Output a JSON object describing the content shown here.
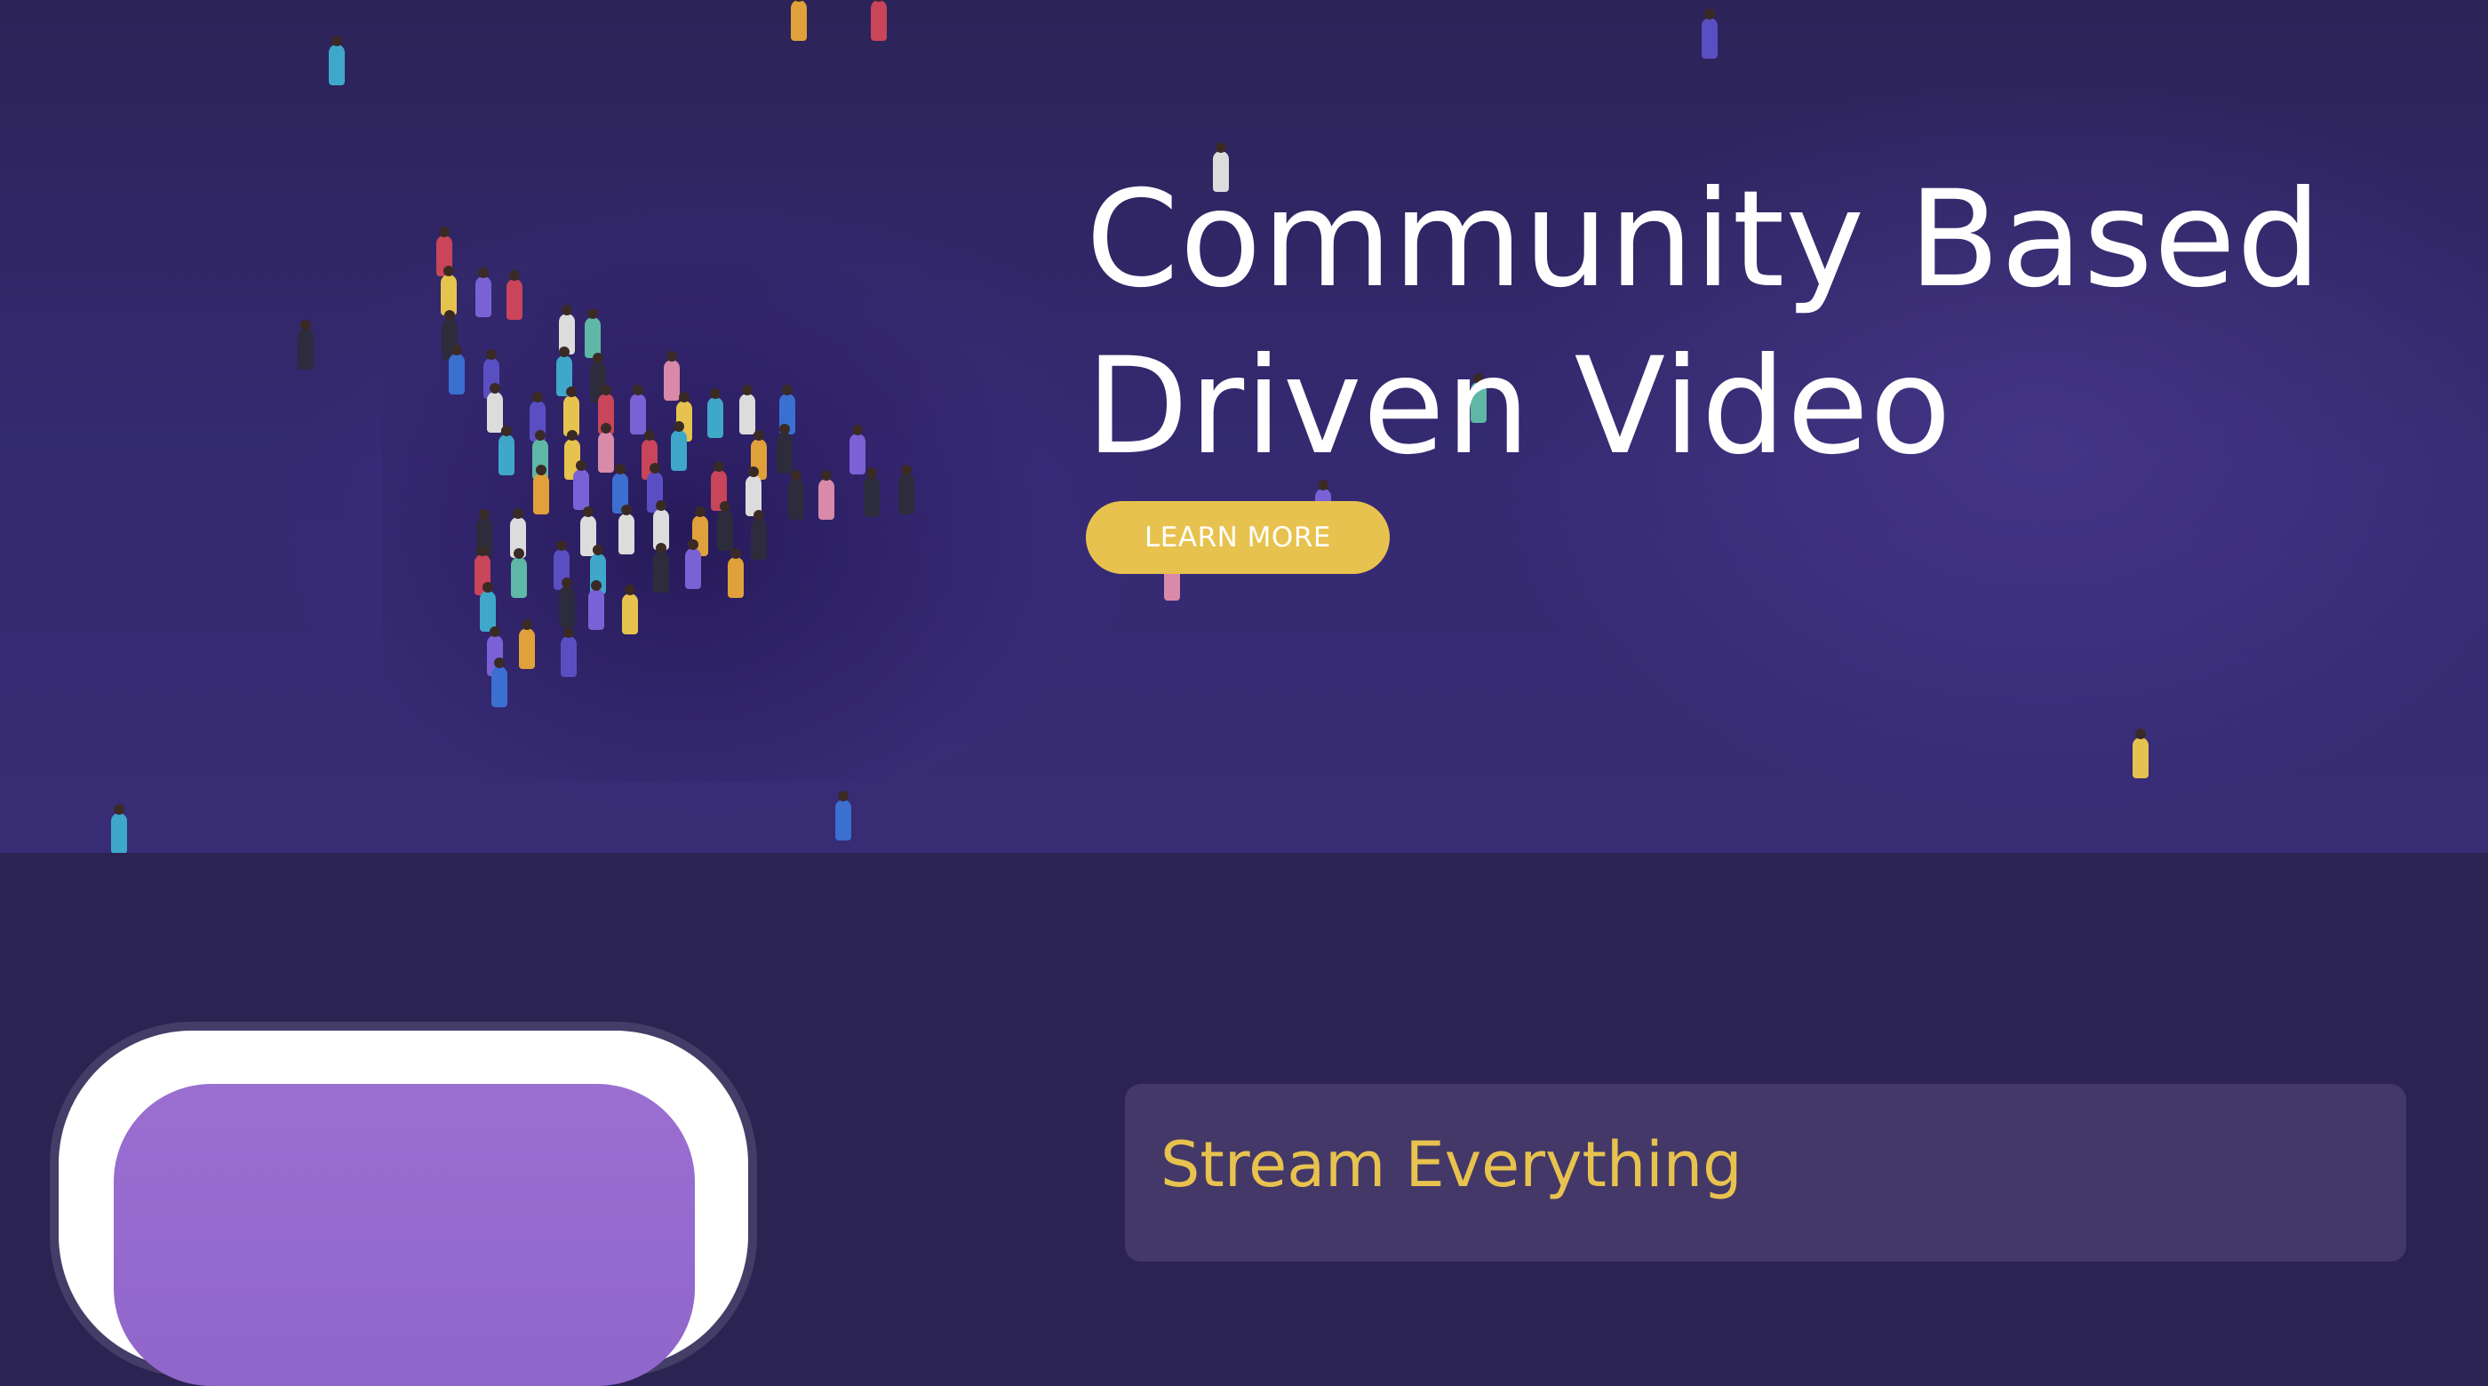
{
  "hero": {
    "title_line1": "Community Based",
    "title_line2": "Driven Video",
    "cta_label": "LEARN MORE",
    "accent_color": "#e8c24e",
    "background_color": "#352a72"
  },
  "features": {
    "card_title": "Stream Everything",
    "card_color": "#433867"
  },
  "device": {
    "screen_color": "#9b6ed1"
  }
}
